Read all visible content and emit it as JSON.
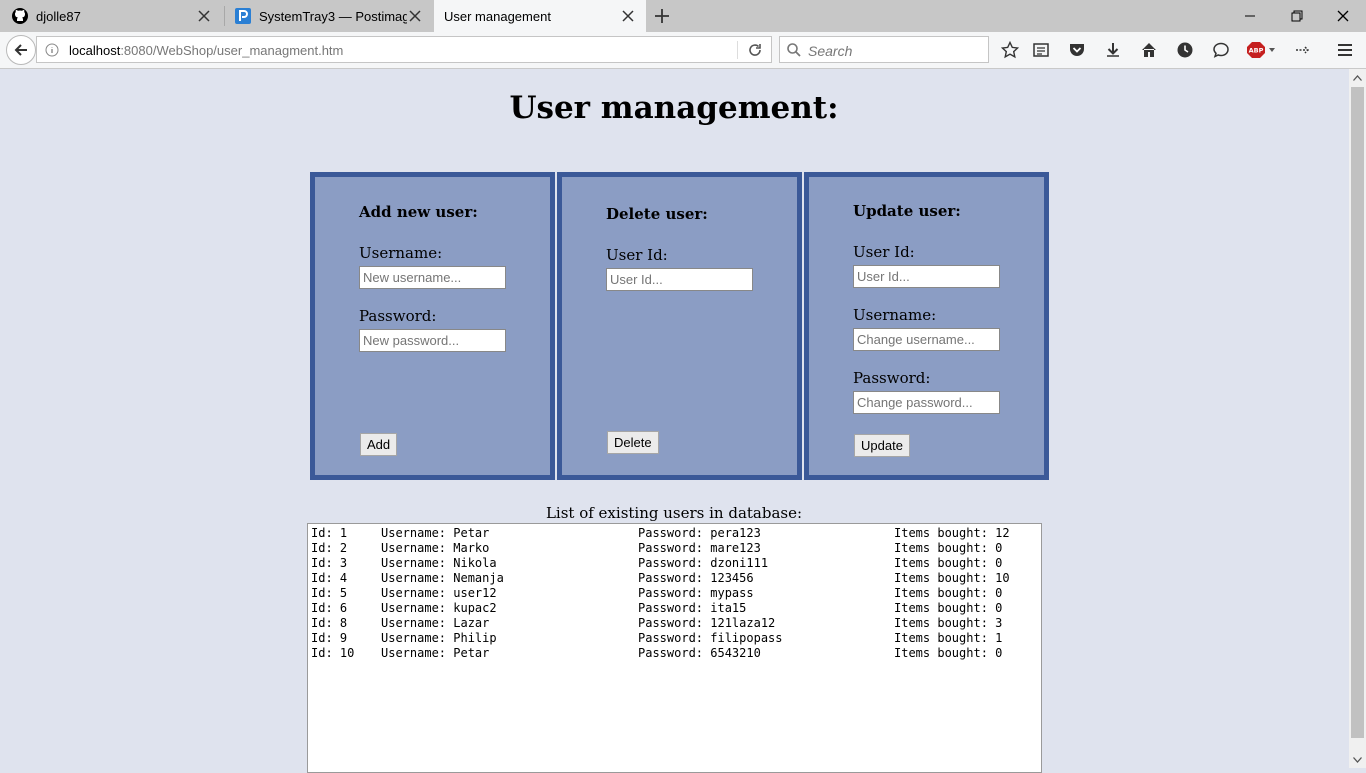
{
  "browser": {
    "tabs": [
      {
        "title": "djolle87",
        "icon": "github-icon",
        "active": false
      },
      {
        "title": "SystemTray3 — Postimag...",
        "icon": "postimage-icon",
        "active": false
      },
      {
        "title": "User management",
        "icon": "",
        "active": true
      }
    ],
    "url": {
      "host": "localhost",
      "path": ":8080/WebShop/user_managment.htm"
    },
    "search_placeholder": "Search",
    "toolbar_icons": [
      "bookmark-star-icon",
      "reading-list-icon",
      "pocket-icon",
      "download-icon",
      "home-icon",
      "history-icon",
      "chat-icon",
      "adblock-icon",
      "sync-icon",
      "menu-icon"
    ],
    "adblock_label": "ABP"
  },
  "page": {
    "title": "User management:",
    "add_panel": {
      "heading": "Add new user:",
      "username_label": "Username:",
      "username_placeholder": "New username...",
      "password_label": "Password:",
      "password_placeholder": "New password...",
      "button": "Add"
    },
    "delete_panel": {
      "heading": "Delete user:",
      "userid_label": "User Id:",
      "userid_placeholder": "User Id...",
      "button": "Delete"
    },
    "update_panel": {
      "heading": "Update user:",
      "userid_label": "User Id:",
      "userid_placeholder": "User Id...",
      "username_label": "Username:",
      "username_placeholder": "Change username...",
      "password_label": "Password:",
      "password_placeholder": "Change password...",
      "button": "Update"
    },
    "list_label": "List of existing users in database:",
    "users": [
      {
        "id": "Id: 1",
        "username": "Username: Petar",
        "password": "Password: pera123",
        "items": "Items bought: 12"
      },
      {
        "id": "Id: 2",
        "username": "Username: Marko",
        "password": "Password: mare123",
        "items": "Items bought: 0"
      },
      {
        "id": "Id: 3",
        "username": "Username: Nikola",
        "password": "Password: dzoni111",
        "items": "Items bought: 0"
      },
      {
        "id": "Id: 4",
        "username": "Username: Nemanja",
        "password": "Password: 123456",
        "items": "Items bought: 10"
      },
      {
        "id": "Id: 5",
        "username": "Username: user12",
        "password": "Password: mypass",
        "items": "Items bought: 0"
      },
      {
        "id": "Id: 6",
        "username": "Username: kupac2",
        "password": "Password: ita15",
        "items": "Items bought: 0"
      },
      {
        "id": "Id: 8",
        "username": "Username: Lazar",
        "password": "Password: 121laza12",
        "items": "Items bought: 3"
      },
      {
        "id": "Id: 9",
        "username": "Username: Philip",
        "password": "Password: filipopass",
        "items": "Items bought: 1"
      },
      {
        "id": "Id: 10",
        "username": "Username: Petar",
        "password": "Password: 6543210",
        "items": "Items bought: 0"
      }
    ]
  },
  "colors": {
    "panel_bg": "#8b9dc4",
    "panel_border": "#3b5998",
    "page_bg": "#dfe3ee"
  }
}
